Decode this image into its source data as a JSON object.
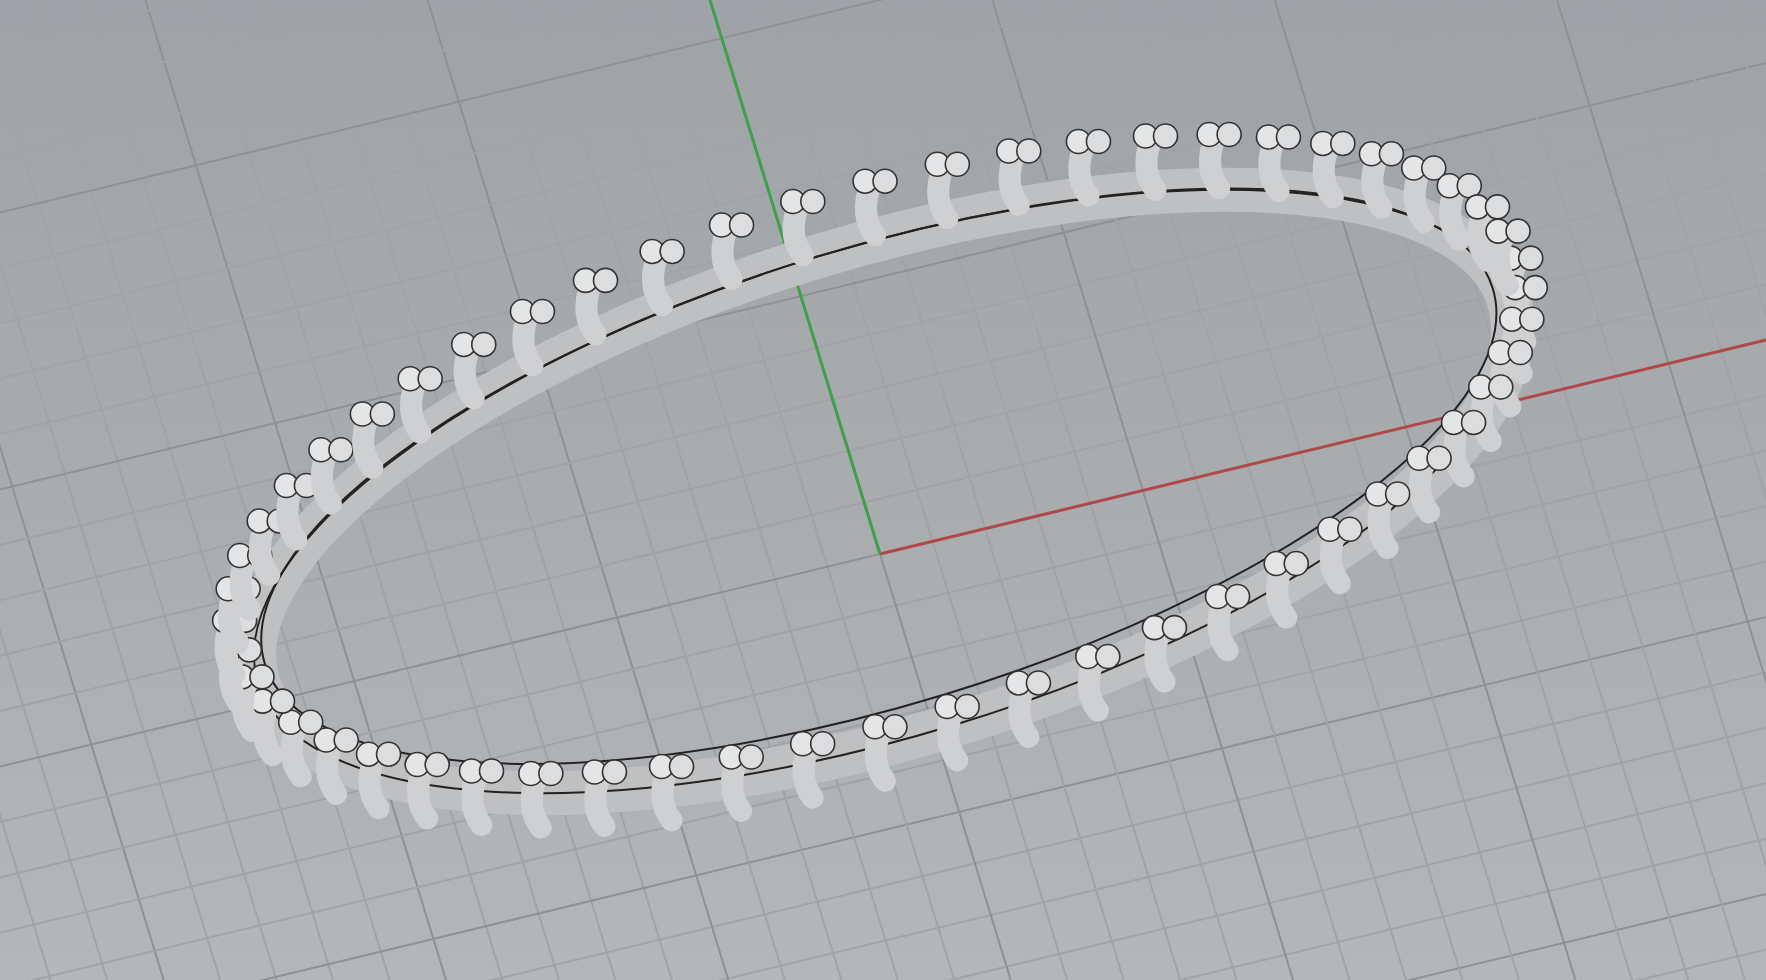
{
  "viewport": {
    "axes": [
      {
        "kind": "x",
        "color": "#b04848"
      },
      {
        "kind": "y",
        "color": "#3fa04a"
      }
    ]
  }
}
